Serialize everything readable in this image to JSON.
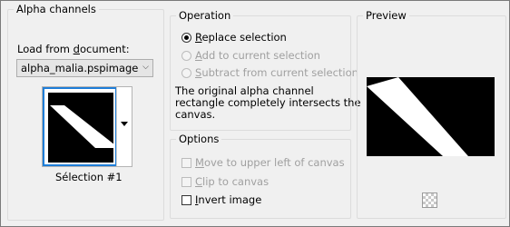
{
  "alpha": {
    "title": "Alpha channels",
    "load_label_pre": "Load from ",
    "load_label_u": "d",
    "load_label_post": "ocument:",
    "document_value": "alpha_malia.pspimage",
    "selection_name": "Sélection #1"
  },
  "operation": {
    "title": "Operation",
    "replace": {
      "u": "R",
      "rest": "eplace selection",
      "checked": true
    },
    "add": {
      "u": "A",
      "rest": "dd to current selection"
    },
    "subtract": {
      "u": "S",
      "rest": "ubtract from current selection"
    },
    "message_line1": "The original alpha channel",
    "message_line2": "rectangle completely intersects the",
    "message_line3": "canvas."
  },
  "options": {
    "title": "Options",
    "move": {
      "u": "M",
      "rest": "ove to upper left of canvas"
    },
    "clip": {
      "u": "C",
      "rest": "lip to canvas"
    },
    "invert": {
      "u": "I",
      "rest": "nvert image",
      "checked": false
    }
  },
  "preview": {
    "title": "Preview"
  },
  "icons": {
    "dropdown": "chevron-down-icon",
    "transparency": "checkerboard-icon"
  },
  "colors": {
    "accent_border": "#1f7ed8",
    "disabled_text": "#a0a0a0"
  }
}
